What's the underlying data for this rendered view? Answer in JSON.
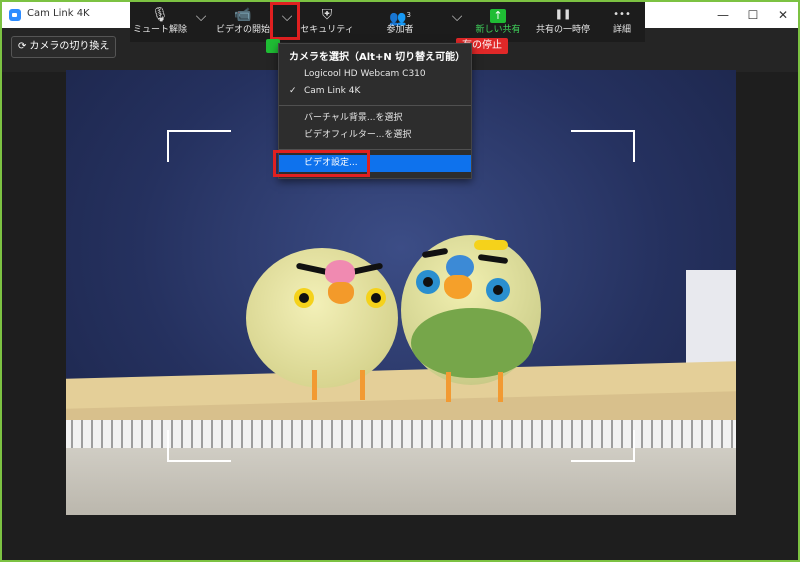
{
  "window": {
    "title": "Cam Link 4K",
    "minimize": "—",
    "maximize": "☐",
    "close": "✕"
  },
  "top_left_button": {
    "label": "カメラの切り換え"
  },
  "toolbar": {
    "items": [
      {
        "label": "ミュート解除",
        "icon": "mic-muted-icon",
        "glyph": "🎙"
      },
      {
        "label": "ビデオの開始",
        "icon": "video-off-icon",
        "glyph": "📹"
      },
      {
        "label": "セキュリティ",
        "icon": "shield-icon",
        "glyph": "⛨"
      },
      {
        "label": "参加者",
        "icon": "participants-icon",
        "glyph": "👥",
        "count": "3"
      },
      {
        "label": "新しい共有",
        "icon": "share-up-icon",
        "glyph": "↑"
      },
      {
        "label": "共有の一時停",
        "icon": "pause-icon",
        "glyph": "❚❚"
      },
      {
        "label": "詳細",
        "icon": "more-icon",
        "glyph": "•••"
      }
    ],
    "chevron": "⌵"
  },
  "share_bar": {
    "stop_label": "有の停止"
  },
  "camera_menu": {
    "header": "カメラを選択（Alt+N 切り替え可能）",
    "cameras": [
      {
        "label": "Logicool HD Webcam C310",
        "checked": false
      },
      {
        "label": "Cam Link 4K",
        "checked": true
      }
    ],
    "check_glyph": "✓",
    "options": [
      {
        "label": "バーチャル背景...を選択"
      },
      {
        "label": "ビデオフィルター...を選択"
      }
    ],
    "settings": {
      "label": "ビデオ設定...",
      "highlighted": true
    }
  },
  "colors": {
    "accent_blue": "#0e72ed",
    "highlight_red": "#e02020",
    "share_green": "#1fbd34",
    "window_border_green": "#7cc242"
  }
}
